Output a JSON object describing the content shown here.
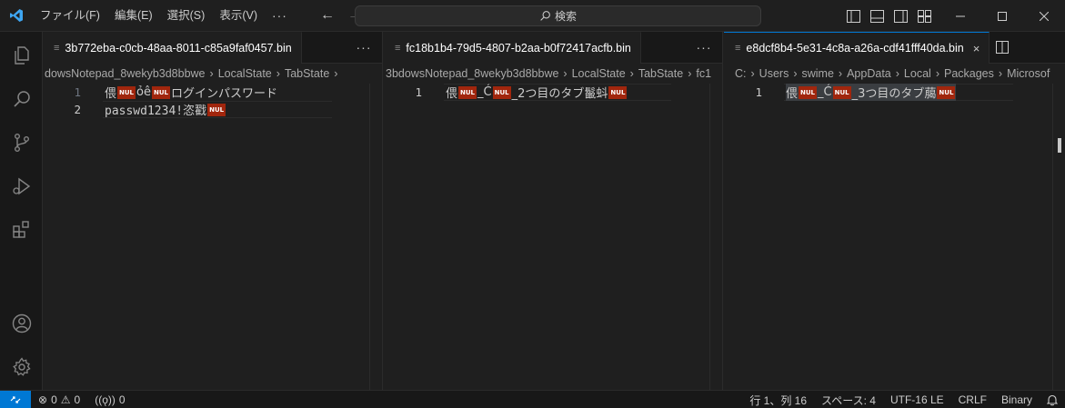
{
  "colors": {
    "accent": "#0078d4",
    "nul_badge": "#a1260d",
    "background": "#1f1f1f"
  },
  "menu": {
    "items": [
      "ファイル(F)",
      "編集(E)",
      "選択(S)",
      "表示(V)"
    ],
    "more": "···"
  },
  "search": {
    "label": "検索"
  },
  "window_controls": [
    "minimize",
    "maximize",
    "close"
  ],
  "activity_bar": [
    "explorer-icon",
    "search-icon",
    "source-control-icon",
    "run-debug-icon",
    "extensions-icon",
    "accounts-icon",
    "manage-gear-icon"
  ],
  "groups": [
    {
      "tab": {
        "label": "3b772eba-c0cb-48aa-8011-c85a9faf0457.bin"
      },
      "more": "···",
      "breadcrumb": [
        "dowsNotepad_8wekyb3d8bbwe",
        "LocalState",
        "TabState",
        ""
      ],
      "lines": [
        {
          "num": "1",
          "segments": [
            "偎",
            "NUL",
            "ỏê",
            "NUL",
            "ログインパスワード"
          ]
        },
        {
          "num": "2",
          "segments": [
            "passwd1234!恣戳",
            "NUL"
          ]
        }
      ]
    },
    {
      "tab": {
        "label": "fc18b1b4-79d5-4807-b2aa-b0f72417acfb.bin"
      },
      "more": "···",
      "breadcrumb": [
        "3bdowsNotepad_8wekyb3d8bbwe",
        "LocalState",
        "TabState",
        "fc1"
      ],
      "lines": [
        {
          "num": "1",
          "segments": [
            "偎",
            "NUL",
            "_Ć",
            "NUL",
            "_2つ目のタブ鬣蚪",
            "NUL"
          ]
        }
      ]
    },
    {
      "tab": {
        "label": "e8dcf8b4-5e31-4c8a-a26a-cdf41fff40da.bin",
        "close": "×"
      },
      "breadcrumb": [
        "C:",
        "Users",
        "swime",
        "AppData",
        "Local",
        "Packages",
        "Microsof"
      ],
      "lines": [
        {
          "num": "1",
          "segments": [
            "偎",
            "NUL",
            "_Ć",
            "NUL",
            "_3つ目のタブ﨟",
            "NUL"
          ]
        }
      ]
    }
  ],
  "status": {
    "errors": "0",
    "warnings": "0",
    "ports": "0",
    "position": "行 1、列 16",
    "spaces": "スペース: 4",
    "encoding": "UTF-16 LE",
    "eol": "CRLF",
    "language": "Binary"
  }
}
